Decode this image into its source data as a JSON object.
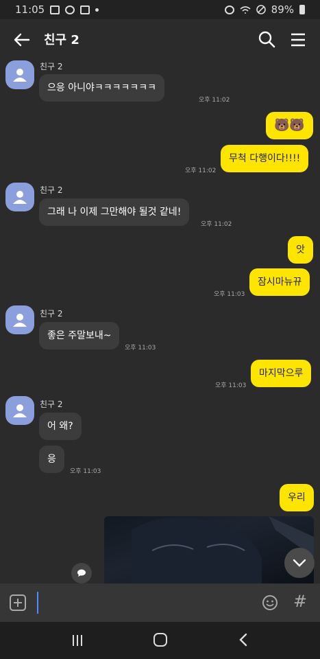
{
  "status": {
    "time": "11:05",
    "battery": "89%"
  },
  "header": {
    "title": "친구 2"
  },
  "messages": {
    "m1": {
      "sender": "친구 2",
      "text": "으응 아니야ㅋㅋㅋㅋㅋㅋㅋ",
      "time": "오후 11:02"
    },
    "m2": {
      "emoji": "🐻🐻"
    },
    "m3": {
      "text": "무척 다행이다!!!!",
      "time": "오후 11:02"
    },
    "m4": {
      "sender": "친구 2",
      "text": "그래 나 이제 그만해야 될것 같네!",
      "time": "오후 11:02"
    },
    "m5": {
      "text": "앗"
    },
    "m6": {
      "text": "잠시마뉴뀨",
      "time": "오후 11:03"
    },
    "m7": {
      "sender": "친구 2",
      "text": "좋은 주말보내~",
      "time": "오후 11:03"
    },
    "m8": {
      "text": "마지막으루",
      "time": "오후 11:03"
    },
    "m9": {
      "sender": "친구 2",
      "text": "어 왜?"
    },
    "m10": {
      "text": "응",
      "time": "오후 11:03"
    },
    "m11": {
      "text": "우리"
    }
  },
  "colors": {
    "accent": "#fee500",
    "avatar": "#8b9fdc",
    "background": "#2b2b2b"
  }
}
